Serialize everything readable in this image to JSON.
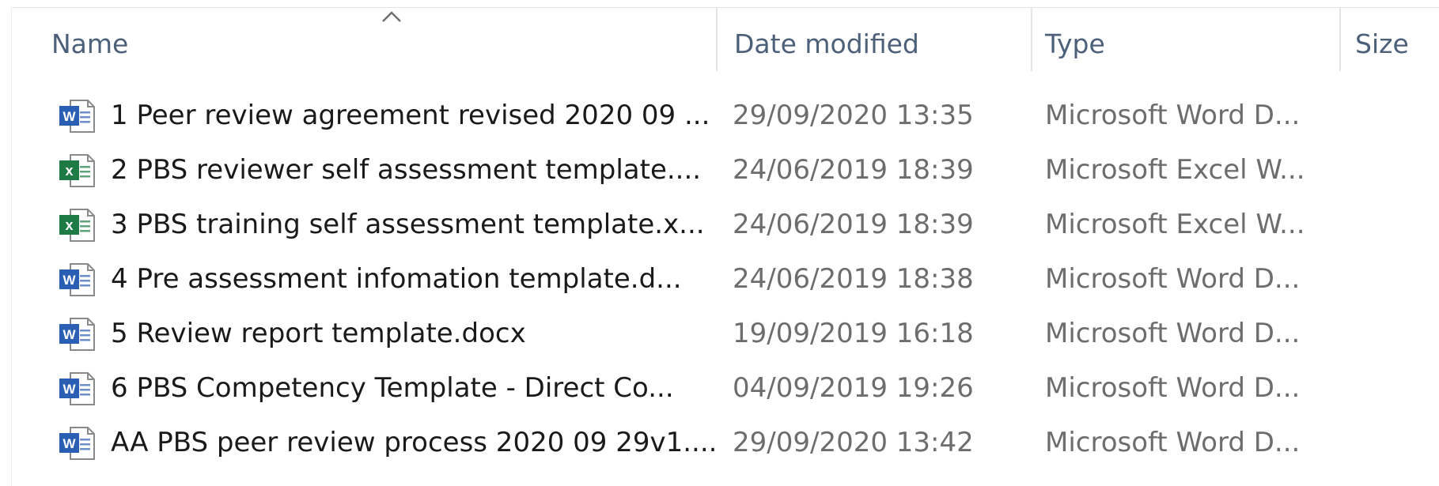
{
  "columns": {
    "name": "Name",
    "date_modified": "Date modified",
    "type": "Type",
    "size": "Size"
  },
  "colors": {
    "header_text": "#4c607a",
    "word_blue": "#2b5fb4",
    "excel_green": "#1e7b45"
  },
  "files": [
    {
      "icon": "word-doc-icon",
      "name": "1 Peer review agreement revised 2020 09 ...",
      "date": "29/09/2020 13:35",
      "type": "Microsoft Word D..."
    },
    {
      "icon": "excel-sheet-icon",
      "name": "2 PBS reviewer self assessment template....",
      "date": "24/06/2019 18:39",
      "type": "Microsoft Excel W..."
    },
    {
      "icon": "excel-sheet-icon",
      "name": "3 PBS training self assessment template.x...",
      "date": "24/06/2019 18:39",
      "type": "Microsoft Excel W..."
    },
    {
      "icon": "word-doc-icon",
      "name": "4 Pre assessment infomation template.d...",
      "date": "24/06/2019 18:38",
      "type": "Microsoft Word D..."
    },
    {
      "icon": "word-doc-icon",
      "name": "5 Review report template.docx",
      "date": "19/09/2019 16:18",
      "type": "Microsoft Word D..."
    },
    {
      "icon": "word-doc-icon",
      "name": "6 PBS Competency Template - Direct Co...",
      "date": "04/09/2019 19:26",
      "type": "Microsoft Word D..."
    },
    {
      "icon": "word-doc-icon",
      "name": "AA PBS peer review process 2020 09 29v1....",
      "date": "29/09/2020 13:42",
      "type": "Microsoft Word D..."
    }
  ]
}
